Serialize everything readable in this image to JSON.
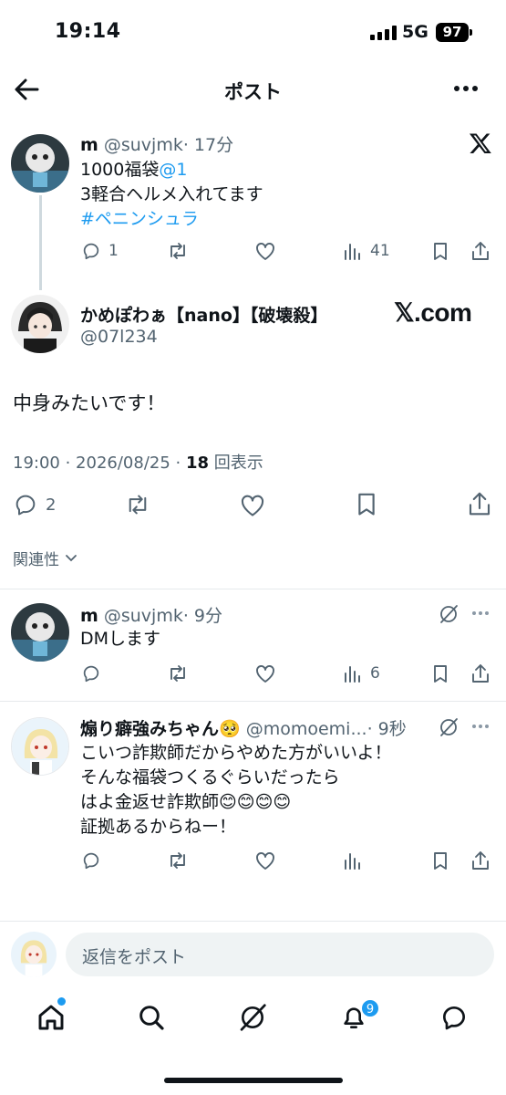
{
  "status_bar": {
    "time": "19:14",
    "network": "5G",
    "battery": "97"
  },
  "header": {
    "title": "ポスト"
  },
  "quoted_post": {
    "name": "m",
    "handle": "@suvjmk",
    "time": "· 17分",
    "line1_text": "1000福袋",
    "line1_mention": "@1",
    "line2": "3軽合ヘルメ入れてます",
    "hashtag": "#ペニンシュラ",
    "replies": "1",
    "views": "41"
  },
  "main_post": {
    "name": "かめぽわぁ【nano】【破壊殺】",
    "handle": "@07l234",
    "watermark": "𝕏.com",
    "text": "中身みたいです！",
    "meta_time": "19:00 · 2026/08/25 · ",
    "views_count": "18",
    "views_label": "回表示",
    "replies": "2"
  },
  "sort": {
    "label": "関連性"
  },
  "replies": [
    {
      "name": "m",
      "handle": "@suvjmk",
      "time": "· 9分",
      "text": "DMします",
      "views": "6"
    },
    {
      "name": "煽り癖強みちゃん🥺",
      "handle": "@momoemi...",
      "time": "· 9秒",
      "line1": "こいつ詐欺師だからやめた方がいいよ！",
      "line2": "そんな福袋つくるぐらいだったら",
      "line3": "はよ金返せ詐欺師😊😊😊😊",
      "line4": "証拠あるからねー！"
    }
  ],
  "composer": {
    "placeholder": "返信をポスト"
  },
  "tab_bar": {
    "notifications_badge": "9"
  },
  "colors": {
    "accent": "#1d9bf0",
    "text": "#0f1419",
    "muted": "#536471"
  }
}
